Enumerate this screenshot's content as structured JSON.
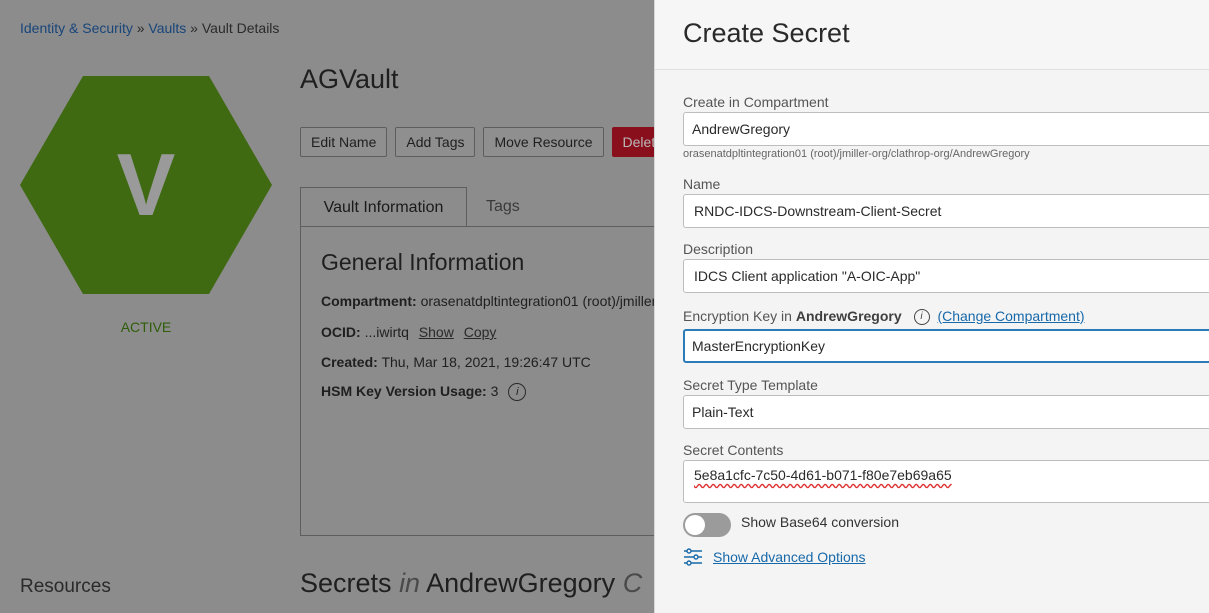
{
  "breadcrumb": {
    "items": [
      "Identity & Security",
      "Vaults",
      "Vault Details"
    ],
    "separator": "»"
  },
  "vault": {
    "initial": "V",
    "status": "ACTIVE",
    "name": "AGVault",
    "hex_color": "#3f6a12"
  },
  "actions": {
    "edit_name": "Edit Name",
    "add_tags": "Add Tags",
    "move_resource": "Move Resource",
    "delete": "Delet"
  },
  "tabs": {
    "vault_information": "Vault Information",
    "tags": "Tags"
  },
  "general_info": {
    "title": "General Information",
    "compartment_label": "Compartment:",
    "compartment_value": "orasenatdpltintegration01 (root)/jmiller",
    "ocid_label": "OCID:",
    "ocid_value": "...iwirtq",
    "show": "Show",
    "copy": "Copy",
    "created_label": "Created:",
    "created_value": "Thu, Mar 18, 2021, 19:26:47 UTC",
    "hsm_label": "HSM Key Version Usage:",
    "hsm_value": "3",
    "info_glyph": "i"
  },
  "resources": "Resources",
  "secrets_heading": {
    "prefix": "Secrets",
    "in": "in",
    "compartment": "AndrewGregory",
    "suffix": "C"
  },
  "drawer": {
    "title": "Create Secret",
    "compartment": {
      "label": "Create in Compartment",
      "value": "AndrewGregory",
      "helper": "orasenatdpltintegration01 (root)/jmiller-org/clathrop-org/AndrewGregory"
    },
    "name": {
      "label": "Name",
      "value": "RNDC-IDCS-Downstream-Client-Secret"
    },
    "description": {
      "label": "Description",
      "value": "IDCS Client application \"A-OIC-App\""
    },
    "encryption_key": {
      "label_prefix": "Encryption Key in",
      "label_compartment": "AndrewGregory",
      "info_glyph": "i",
      "change_link": "(Change Compartment)",
      "value": "MasterEncryptionKey"
    },
    "secret_type": {
      "label": "Secret Type Template",
      "value": "Plain-Text"
    },
    "secret_contents": {
      "label": "Secret Contents",
      "value": "5e8a1cfc-7c50-4d61-b071-f80e7eb69a65"
    },
    "base64_toggle": {
      "label": "Show Base64 conversion",
      "on": false
    },
    "advanced_link": "Show Advanced Options"
  },
  "colors": {
    "overlay_bg": "#8c8c8c",
    "accent_blue": "#1769aa",
    "focus_border": "#2b7bb9"
  }
}
